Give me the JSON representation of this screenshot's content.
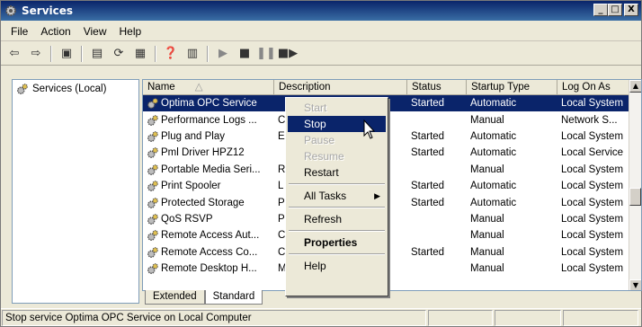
{
  "window": {
    "title": "Services",
    "controls": {
      "minimize": "_",
      "maximize": "□",
      "close": "X"
    }
  },
  "menu": [
    "File",
    "Action",
    "View",
    "Help"
  ],
  "toolbar": [
    "back-arrow-icon",
    "forward-arrow-icon",
    "console-tree-icon",
    "properties-icon",
    "refresh-icon",
    "export-list-icon",
    "help-icon",
    "console-pane-icon",
    "start-service-icon",
    "stop-service-icon",
    "pause-service-icon",
    "restart-service-icon"
  ],
  "tree": {
    "root": "Services (Local)"
  },
  "columns": [
    "Name",
    "Description",
    "Status",
    "Startup Type",
    "Log On As"
  ],
  "rows": [
    {
      "name": "Optima OPC Service",
      "desc": "",
      "status": "Started",
      "startup": "Automatic",
      "logon": "Local System",
      "selected": true
    },
    {
      "name": "Performance Logs ...",
      "desc": "C",
      "status": "",
      "startup": "Manual",
      "logon": "Network S..."
    },
    {
      "name": "Plug and Play",
      "desc": "E",
      "status": "Started",
      "startup": "Automatic",
      "logon": "Local System"
    },
    {
      "name": "Pml Driver HPZ12",
      "desc": "",
      "status": "Started",
      "startup": "Automatic",
      "logon": "Local Service"
    },
    {
      "name": "Portable Media Seri...",
      "desc": "R",
      "status": "",
      "startup": "Manual",
      "logon": "Local System"
    },
    {
      "name": "Print Spooler",
      "desc": "L",
      "status": "Started",
      "startup": "Automatic",
      "logon": "Local System"
    },
    {
      "name": "Protected Storage",
      "desc": "P",
      "status": "Started",
      "startup": "Automatic",
      "logon": "Local System"
    },
    {
      "name": "QoS RSVP",
      "desc": "P",
      "status": "",
      "startup": "Manual",
      "logon": "Local System"
    },
    {
      "name": "Remote Access Aut...",
      "desc": "C",
      "status": "",
      "startup": "Manual",
      "logon": "Local System"
    },
    {
      "name": "Remote Access Co...",
      "desc": "C",
      "status": "Started",
      "startup": "Manual",
      "logon": "Local System"
    },
    {
      "name": "Remote Desktop H...",
      "desc": "M",
      "status": "",
      "startup": "Manual",
      "logon": "Local System"
    }
  ],
  "tabs": [
    "Extended",
    "Standard"
  ],
  "context_menu": [
    {
      "label": "Start",
      "disabled": true
    },
    {
      "label": "Stop",
      "highlighted": true
    },
    {
      "label": "Pause",
      "disabled": true
    },
    {
      "label": "Resume",
      "disabled": true
    },
    {
      "label": "Restart"
    },
    {
      "sep": true
    },
    {
      "label": "All Tasks",
      "submenu": true
    },
    {
      "sep": true
    },
    {
      "label": "Refresh"
    },
    {
      "sep": true
    },
    {
      "label": "Properties",
      "bold": true
    },
    {
      "sep": true
    },
    {
      "label": "Help"
    }
  ],
  "statusbar": "Stop service Optima OPC Service on Local Computer"
}
